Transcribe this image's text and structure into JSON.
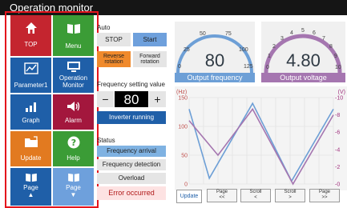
{
  "window": {
    "title": "Operation monitor"
  },
  "nav": {
    "tiles": [
      {
        "label": "TOP",
        "icon": "home-icon",
        "color": "#c4252f"
      },
      {
        "label": "Menu",
        "icon": "book-icon",
        "color": "#3b9c36"
      },
      {
        "label": "Parameter1",
        "icon": "chart-icon",
        "color": "#1f5fa8"
      },
      {
        "label": "Operation\nMonitor",
        "icon": "monitor-icon",
        "color": "#1f5fa8"
      },
      {
        "label": "Graph",
        "icon": "bar-chart-icon",
        "color": "#1f5fa8"
      },
      {
        "label": "Alarm",
        "icon": "speaker-icon",
        "color": "#a3173d"
      },
      {
        "label": "Update",
        "icon": "folder-icon",
        "color": "#e27a20"
      },
      {
        "label": "Help",
        "icon": "help-icon",
        "color": "#3b9c36"
      },
      {
        "label": "Page\n▲",
        "icon": "book-icon",
        "color": "#1f5fa8"
      },
      {
        "label": "Page\n▼",
        "icon": "book-icon",
        "color": "#6ea0dc"
      }
    ]
  },
  "controls": {
    "auto_label": "Auto",
    "stop": "STOP",
    "start": "Start",
    "reverse": "Reverse\nrotation",
    "forward": "Forward\nrotation",
    "freq_setting_label": "Frequency setting value",
    "minus": "−",
    "freq_value": "80",
    "plus": "+",
    "inverter_status": "Inverter running",
    "status_label": "Status",
    "status_items": [
      "Frequency arrival",
      "Frequency detection",
      "Overload",
      "Error occurred"
    ]
  },
  "gauges": {
    "frequency": {
      "value": "80",
      "caption": "Output frequency",
      "ticks": [
        "0",
        "25",
        "50",
        "75",
        "100",
        "125"
      ],
      "color": "#6d9fd6"
    },
    "voltage": {
      "value": "4.80",
      "caption": "Output voltage",
      "ticks": [
        "0",
        "1",
        "2",
        "3",
        "4",
        "5",
        "6",
        "7",
        "8",
        "9",
        "10"
      ],
      "color": "#a576b0"
    }
  },
  "chart_data": {
    "type": "line",
    "left_unit": "(Hz)",
    "right_unit": "(V)",
    "y_left_ticks": [
      "150",
      "100",
      "50",
      "0"
    ],
    "y_right_ticks": [
      "10",
      "8",
      "6",
      "4",
      "2",
      "0"
    ],
    "ylim_left": [
      0,
      150
    ],
    "ylim_right": [
      0,
      10
    ],
    "grid": true,
    "series": [
      {
        "color": "#6d9fd6",
        "x": [
          0,
          14,
          44,
          71,
          100
        ],
        "values": [
          130,
          10,
          140,
          5,
          130
        ]
      },
      {
        "color": "#a576b0",
        "x": [
          0,
          20,
          44,
          72,
          100
        ],
        "values": [
          110,
          50,
          130,
          0,
          120
        ]
      }
    ]
  },
  "bottom_buttons": [
    {
      "label": "Update"
    },
    {
      "label": "Page\n<<"
    },
    {
      "label": "Scroll\n<"
    },
    {
      "label": "Scroll\n>"
    },
    {
      "label": "Page\n>>"
    }
  ]
}
